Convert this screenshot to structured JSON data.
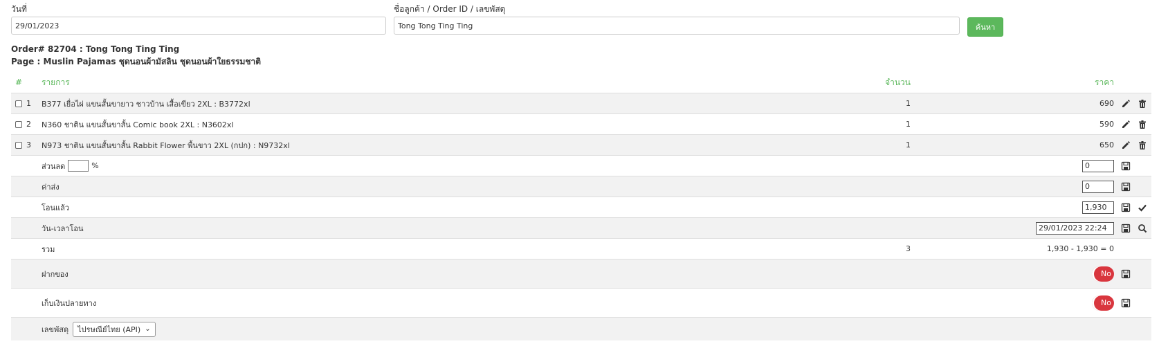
{
  "search": {
    "date_label": "วันที่",
    "date_value": "29/01/2023",
    "customer_label": "ชื่อลูกค้า / Order ID / เลขพัสดุ",
    "customer_value": "Tong Tong Ting Ting",
    "search_button": "ค้นหา"
  },
  "order": {
    "title": "Order# 82704 : Tong Tong Ting Ting",
    "page": "Page : Muslin Pajamas ชุดนอนผ้ามัสลิน ชุดนอนผ้าใยธรรมชาติ"
  },
  "table": {
    "headers": {
      "index": "#",
      "item": "รายการ",
      "qty": "จำนวน",
      "price": "ราคา"
    },
    "items": [
      {
        "no": "1",
        "name": "B377 เยื่อไผ่ แขนสั้นขายาว ชาวบ้าน เสื้อเขียว 2XL : B3772xl",
        "qty": "1",
        "price": "690"
      },
      {
        "no": "2",
        "name": "N360 ชาติน แขนสั้นขาสั้น Comic book 2XL : N3602xl",
        "qty": "1",
        "price": "590"
      },
      {
        "no": "3",
        "name": "N973 ชาติน แขนสั้นขาสั้น Rabbit Flower พื้นขาว 2XL (กปก) : N9732xl",
        "qty": "1",
        "price": "650"
      }
    ],
    "discount": {
      "label": "ส่วนลด",
      "percent_value": "",
      "percent_sign": "%",
      "amount": "0"
    },
    "shipping": {
      "label": "ค่าส่ง",
      "amount": "0"
    },
    "paid": {
      "label": "โอนแล้ว",
      "amount": "1,930"
    },
    "transfer_time": {
      "label": "วัน-เวลาโอน",
      "value": "29/01/2023 22:24"
    },
    "total": {
      "label": "รวม",
      "qty": "3",
      "summary": "1,930 - 1,930 = 0"
    },
    "deposit": {
      "label": "ฝากของ",
      "toggle": "No"
    },
    "cod": {
      "label": "เก็บเงินปลายทาง",
      "toggle": "No"
    },
    "tracking": {
      "label": "เลขพัสดุ",
      "carrier": "ไปรษณีย์ไทย (API)"
    }
  },
  "colors": {
    "accent_green": "#5cb85c",
    "toggle_red": "#d9363e"
  },
  "icons": [
    "pencil-icon",
    "trash-icon",
    "save-icon",
    "check-icon",
    "search-icon",
    "chevron-down-icon"
  ]
}
